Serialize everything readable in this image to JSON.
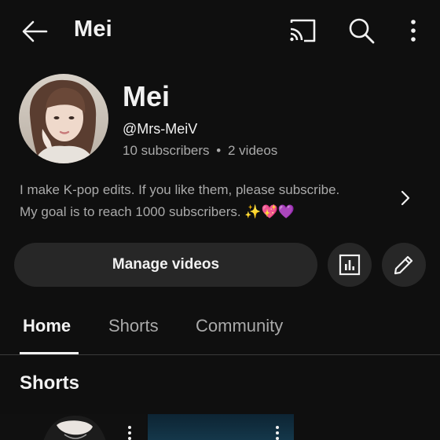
{
  "header": {
    "title": "Mei",
    "icons": [
      "back-arrow-icon",
      "cast-icon",
      "search-icon",
      "more-vert-icon"
    ]
  },
  "channel": {
    "name": "Mei",
    "handle": "@Mrs-MeiV",
    "subscribers": "10 subscribers",
    "separator": "•",
    "videos": "2 videos",
    "description_line1": "I make K-pop edits. If you like them, please subscribe.",
    "description_line2": "My goal is to reach 1000 subscribers.",
    "description_emoji": "✨💖💜"
  },
  "actions": {
    "manage_label": "Manage videos",
    "analytics_icon": "analytics-icon",
    "edit_icon": "edit-pencil-icon"
  },
  "tabs": [
    {
      "label": "Home",
      "active": true
    },
    {
      "label": "Shorts",
      "active": false
    },
    {
      "label": "Community",
      "active": false
    }
  ],
  "section": {
    "title": "Shorts"
  },
  "colors": {
    "background": "#0f0f0f",
    "button_bg": "#272727",
    "text_primary": "#f1f1f1",
    "text_secondary": "#aaaaaa"
  }
}
